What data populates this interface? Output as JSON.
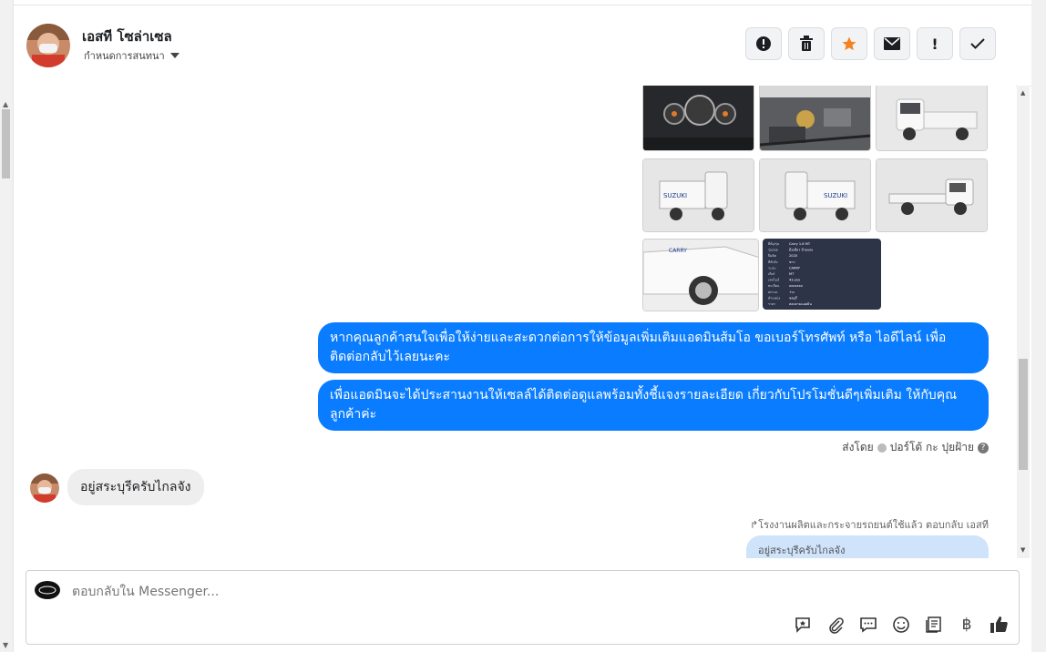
{
  "header": {
    "name": "เอสที โซล่าเซล",
    "subtitle": "กำหนดการสนทนา"
  },
  "actions": [
    {
      "name": "report-icon",
      "glyph": "!"
    },
    {
      "name": "trash-icon",
      "glyph": ""
    },
    {
      "name": "star-icon",
      "glyph": "★"
    },
    {
      "name": "mail-icon",
      "glyph": "✉"
    },
    {
      "name": "alert-icon",
      "glyph": "!"
    },
    {
      "name": "check-icon",
      "glyph": "✓"
    }
  ],
  "messages": {
    "out_1": "หากคุณลูกค้าสนใจเพื่อให้ง่ายและสะดวกต่อการให้ข้อมูลเพิ่มเติมแอดมินส้มโอ ขอเบอร์โทรศัพท์ หรือ ไอดีไลน์ เพื่อติดต่อกลับไว้เลยนะคะ",
    "out_2": "เพื่อแอดมินจะได้ประสานงานให้เซลล์ได้ติดต่อดูแลพร้อมทั้งชี้แจงรายละเอียด เกี่ยวกับโปรโมชั่นดีๆเพิ่มเติม ให้กับคุณลูกค้าค่ะ",
    "sent_by_label": "ส่งโดย",
    "sent_by_name": "ปอร์โต้ กะ ปุยฝ้าย",
    "in_1": "อยู่สระบุรีครับไกลจัง",
    "reply_note": "โรงงานผลิตและกระจายรถยนต์ใช้แล้ว ตอบกลับ เอสที",
    "reply_quote": "อยู่สระบุรีครับไกลจัง"
  },
  "spec_card": {
    "labels": [
      "ยี่ห้อ/รุ่น",
      "รุ่นย่อย",
      "ปีผลิต",
      "สีตัวถัง",
      "ระบบ",
      "เกียร์",
      "เลขไมล์",
      "ทะเบียน",
      "สถานะ",
      "ตำแหน่ง",
      "ราคา"
    ],
    "values": [
      "Carry 1.6 MT",
      "มือเดียว ป้ายแดง",
      "2020",
      "ขาว",
      "CARRY",
      "MT",
      "43,xxx",
      "xxxxxxx",
      "ว่าง",
      "ชลบุรี",
      "สอบถามแอดมิน"
    ]
  },
  "composer": {
    "placeholder": "ตอบกลับใน Messenger...",
    "icons": [
      "saved-reply-icon",
      "attachment-icon",
      "chat-bubble-icon",
      "emoji-icon",
      "notes-icon",
      "baht-icon",
      "like-icon"
    ]
  },
  "colors": {
    "accent": "#0a7cff",
    "star": "#f5821f",
    "incoming_bubble": "#eeeeee",
    "quote_bubble": "#cfe3fb"
  }
}
